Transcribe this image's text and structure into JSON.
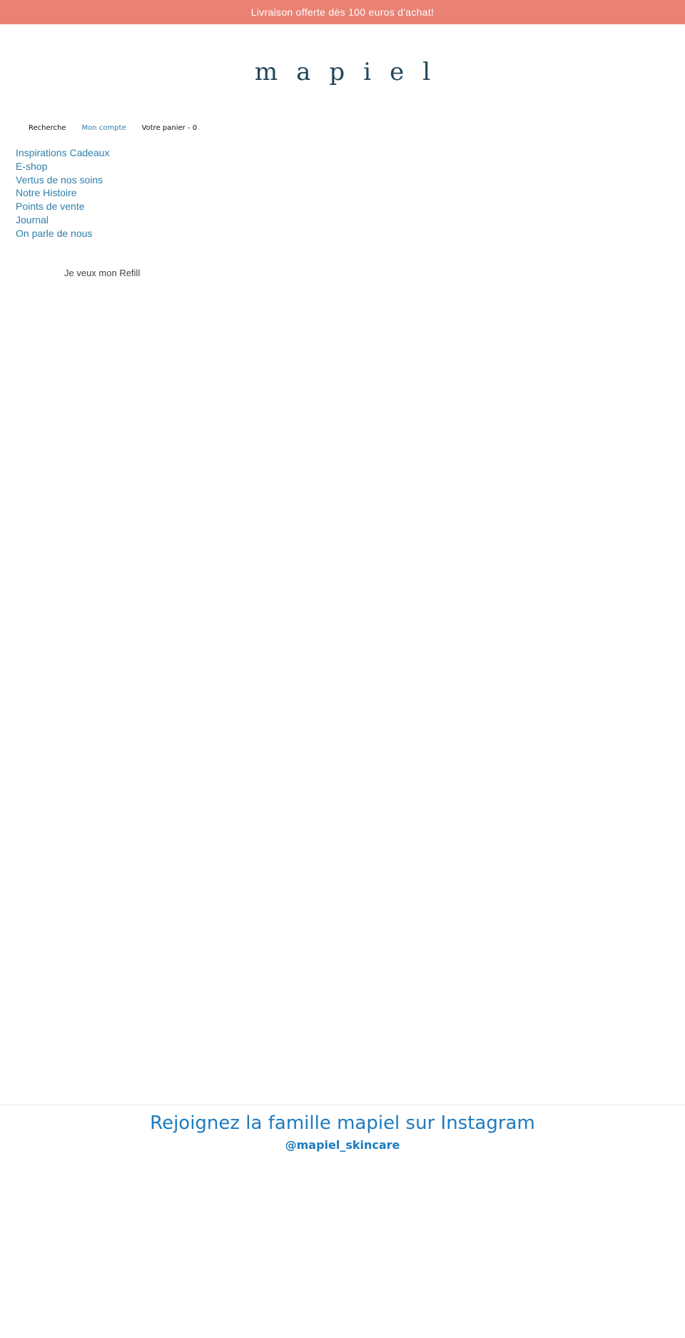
{
  "announcement": {
    "text": "Livraison offerte dès 100 euros d'achat!"
  },
  "logo": {
    "text": "mapiel"
  },
  "top_nav": {
    "search": "Recherche",
    "account": "Mon compte",
    "cart": "Votre panier - 0"
  },
  "main_menu": {
    "items": [
      {
        "label": "Inspirations Cadeaux"
      },
      {
        "label": "E-shop"
      },
      {
        "label": "Vertus de nos soins"
      },
      {
        "label": "Notre Histoire"
      },
      {
        "label": "Points de vente"
      },
      {
        "label": "Journal"
      },
      {
        "label": "On parle de nous"
      }
    ]
  },
  "content": {
    "refill_link": "Je veux mon Refill"
  },
  "instagram": {
    "title": "Rejoignez la famille mapiel sur Instagram",
    "handle": "@mapiel_skincare"
  },
  "colors": {
    "announcement_bg": "#ea8274",
    "logo": "#24455a",
    "accent_blue": "#2f7fab",
    "instagram_blue": "#1d7bbf"
  }
}
